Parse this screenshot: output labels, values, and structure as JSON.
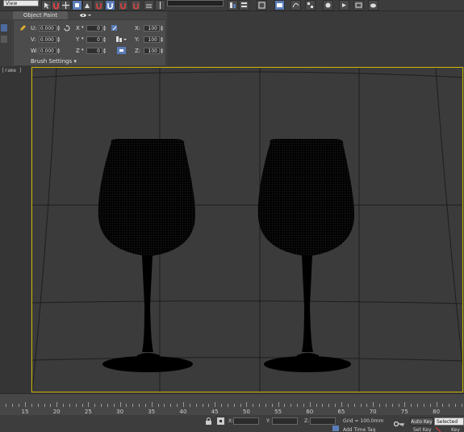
{
  "toolbar": {
    "view_dropdown": "View"
  },
  "ribbon": {
    "tab_object_paint": "Object Paint",
    "tab_eye_icon": "eye-icon",
    "brush_settings": "Brush Settings",
    "offset": {
      "u_label": "U:",
      "u_value": "0.000",
      "v_label": "V:",
      "v_value": "0.000",
      "w_label": "W:",
      "w_value": "0.000"
    },
    "rotate": {
      "x_label": "X",
      "x_value": "0",
      "y_label": "Y",
      "y_value": "0",
      "z_label": "Z",
      "z_value": "0"
    },
    "scale": {
      "x_label": "X:",
      "x_value": "100",
      "y_label": "Y:",
      "y_value": "100",
      "z_label": "Z:",
      "z_value": "100"
    }
  },
  "viewport": {
    "label": "[rame ]",
    "border_color": "#c9b000",
    "object_color": "#000000"
  },
  "timeline": {
    "ticks": [
      "15",
      "20",
      "25",
      "30",
      "35",
      "40",
      "45",
      "50",
      "55",
      "60",
      "65",
      "70",
      "75",
      "80"
    ]
  },
  "status": {
    "x_label": "X:",
    "y_label": "Y:",
    "z_label": "Z:",
    "grid": "Grid = 100.0mm",
    "auto_key": "Auto Key",
    "selected": "Selected",
    "set_key": "Set Key",
    "key_filters": "Key F",
    "add_time_tag": "Add Time Tag"
  }
}
